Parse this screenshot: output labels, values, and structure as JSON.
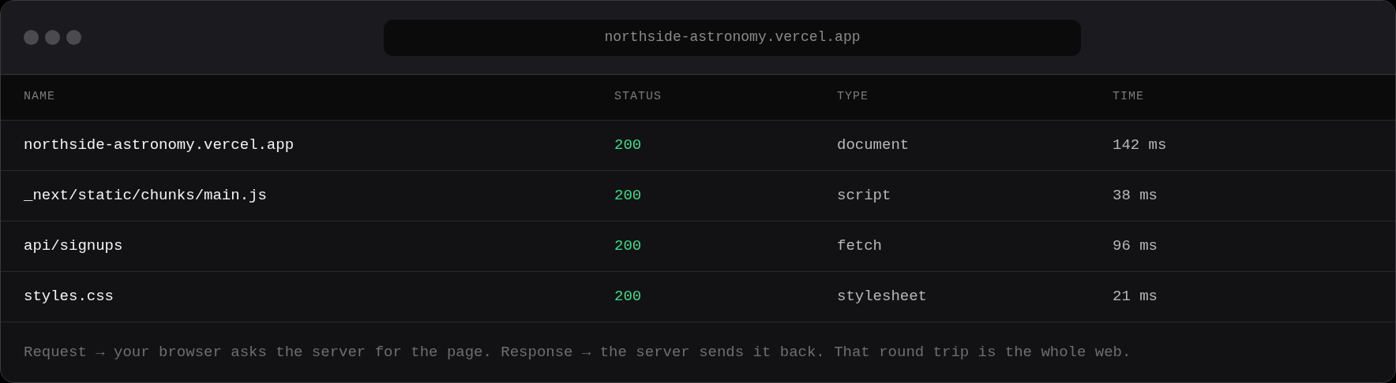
{
  "window": {
    "url": "northside-astronomy.vercel.app"
  },
  "table": {
    "columns": [
      "NAME",
      "STATUS",
      "TYPE",
      "TIME"
    ],
    "rows": [
      {
        "name": "northside-astronomy.vercel.app",
        "status": "200",
        "type": "document",
        "time": "142 ms"
      },
      {
        "name": "_next/static/chunks/main.js",
        "status": "200",
        "type": "script",
        "time": "38 ms"
      },
      {
        "name": "api/signups",
        "status": "200",
        "type": "fetch",
        "time": "96 ms"
      },
      {
        "name": "styles.css",
        "status": "200",
        "type": "stylesheet",
        "time": "21 ms"
      }
    ]
  },
  "footer": "Request → your browser asks the server for the page. Response → the server sends it back. That round trip is the whole web."
}
